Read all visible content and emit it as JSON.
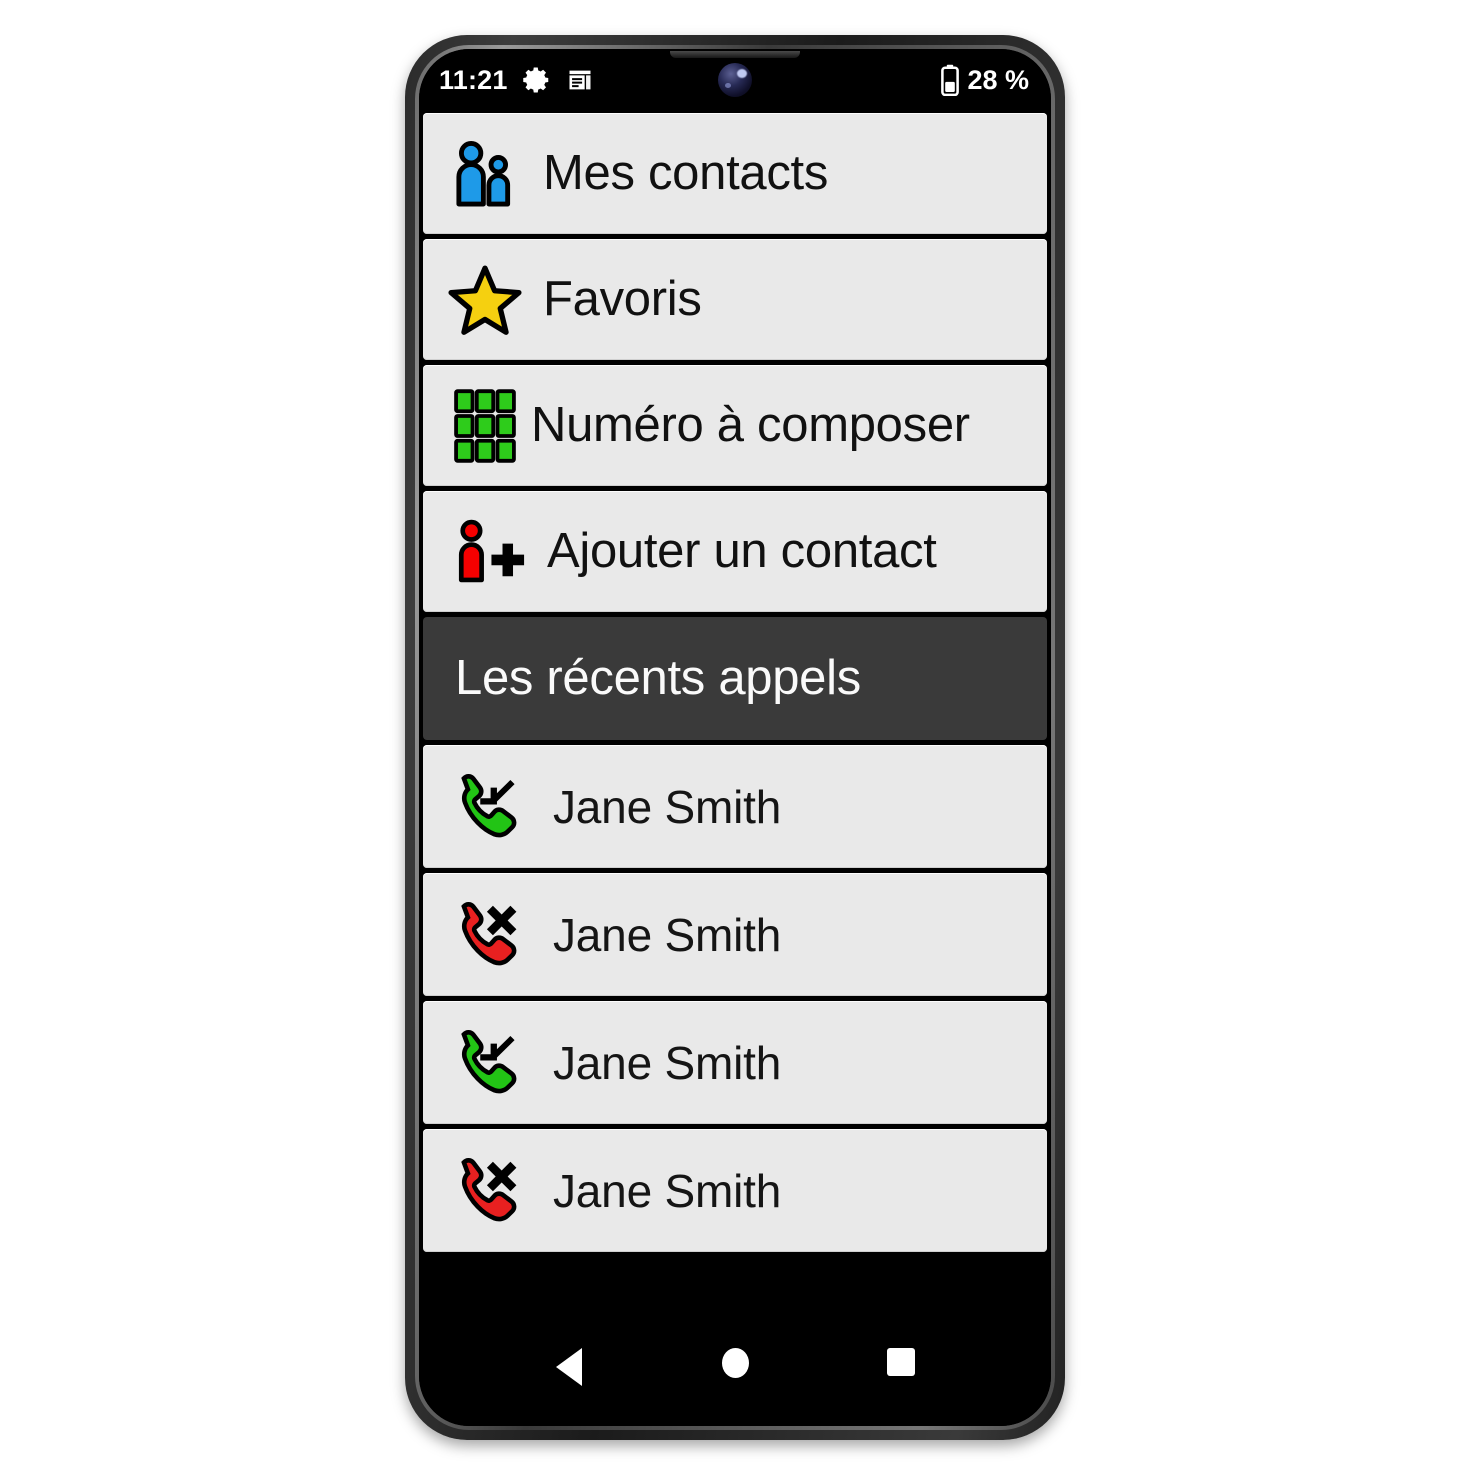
{
  "device": {
    "platform": "android-phone",
    "camera": "front-camera-lens"
  },
  "status_bar": {
    "time": "11:21",
    "icons": [
      "gear-icon",
      "notes-icon"
    ],
    "battery_icon": "battery-icon",
    "battery_level": "28 %"
  },
  "app": {
    "menu": [
      {
        "id": "mes-contacts",
        "label": "Mes contacts",
        "icon": "two-people-icon",
        "icon_color": "#1e9ae8"
      },
      {
        "id": "favoris",
        "label": "Favoris",
        "icon": "star-icon",
        "icon_color": "#f5d010"
      },
      {
        "id": "numero",
        "label": "Numéro à composer",
        "icon": "dialpad-grid-icon",
        "icon_color": "#2ecc1b"
      },
      {
        "id": "ajouter",
        "label": "Ajouter un contact",
        "icon": "person-plus-icon",
        "icon_color": "#f50000"
      }
    ],
    "section": {
      "id": "les-recents-appels",
      "label": "Les récents appels"
    },
    "calls": [
      {
        "id": "call-1",
        "name": "Jane Smith",
        "type": "incoming",
        "icon": "phone-incoming-icon",
        "icon_color": "#22c415"
      },
      {
        "id": "call-2",
        "name": "Jane Smith",
        "type": "missed",
        "icon": "phone-missed-icon",
        "icon_color": "#e82020"
      },
      {
        "id": "call-3",
        "name": "Jane Smith",
        "type": "incoming",
        "icon": "phone-incoming-icon",
        "icon_color": "#22c415"
      },
      {
        "id": "call-4",
        "name": "Jane Smith",
        "type": "missed",
        "icon": "phone-missed-icon",
        "icon_color": "#e82020"
      }
    ]
  },
  "nav_bar": {
    "back": "back-triangle-icon",
    "home": "home-circle-icon",
    "recents": "recents-square-icon"
  },
  "colors": {
    "item_bg": "#e9e9e9",
    "section_bg": "#3a3a3a",
    "screen_bg": "#000000",
    "text": "#111111",
    "section_text": "#fafafa"
  }
}
